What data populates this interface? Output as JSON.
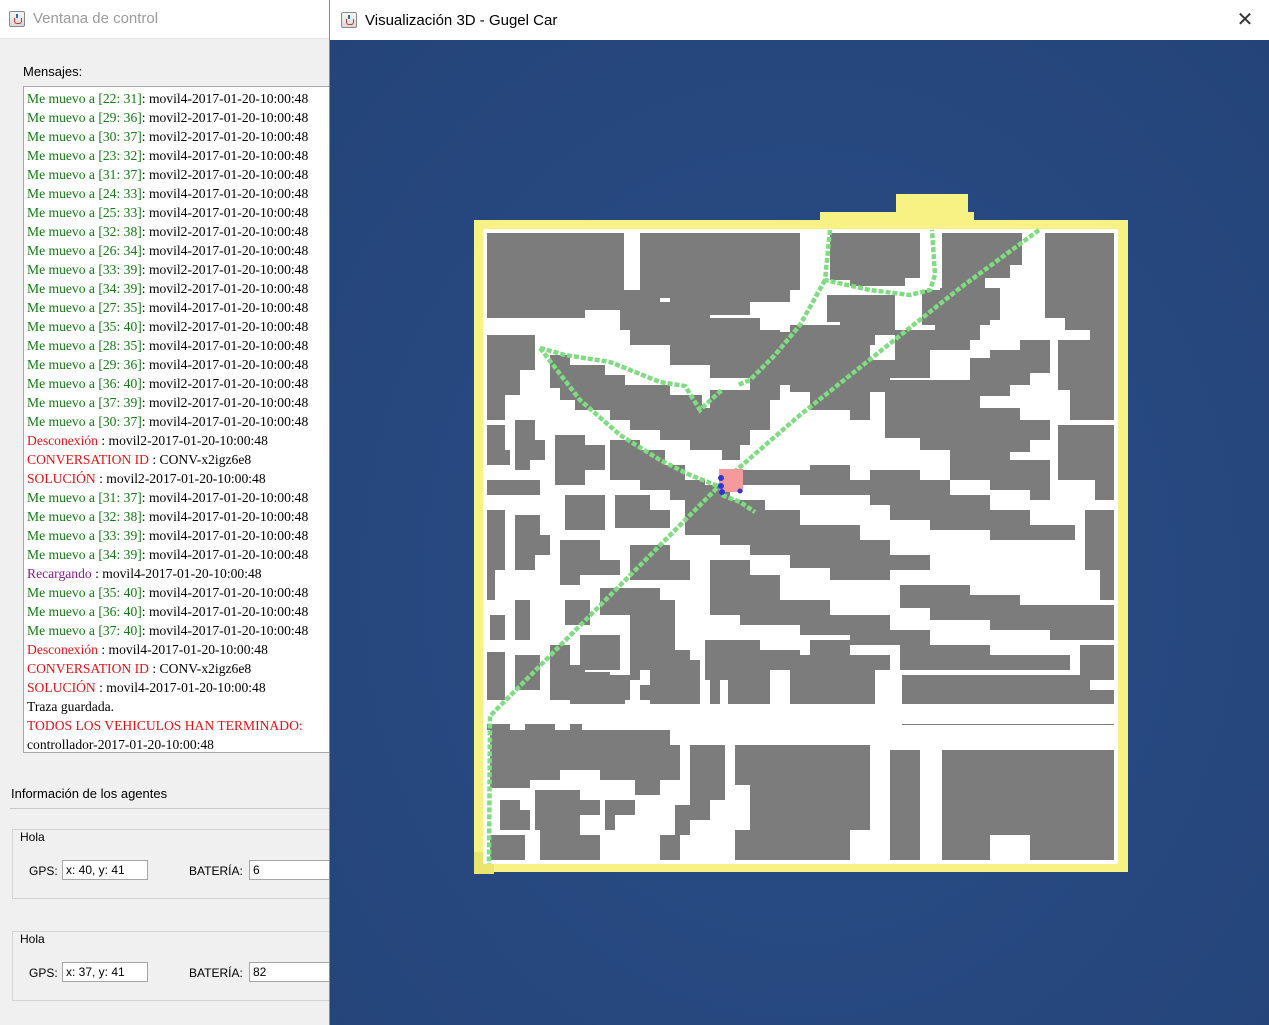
{
  "control_window": {
    "title": "Ventana de control",
    "icon": "java-cup-icon",
    "messages_label": "Mensajes:",
    "messages": [
      {
        "key": "Me muevo a [22: 31]",
        "kind": "green",
        "text": ": movil4-2017-01-20-10:00:48"
      },
      {
        "key": "Me muevo a [29: 36]",
        "kind": "green",
        "text": ": movil2-2017-01-20-10:00:48"
      },
      {
        "key": "Me muevo a [30: 37]",
        "kind": "green",
        "text": ": movil2-2017-01-20-10:00:48"
      },
      {
        "key": "Me muevo a [23: 32]",
        "kind": "green",
        "text": ": movil4-2017-01-20-10:00:48"
      },
      {
        "key": "Me muevo a [31: 37]",
        "kind": "green",
        "text": ": movil2-2017-01-20-10:00:48"
      },
      {
        "key": "Me muevo a [24: 33]",
        "kind": "green",
        "text": ": movil4-2017-01-20-10:00:48"
      },
      {
        "key": "Me muevo a [25: 33]",
        "kind": "green",
        "text": ": movil4-2017-01-20-10:00:48"
      },
      {
        "key": "Me muevo a [32: 38]",
        "kind": "green",
        "text": ": movil2-2017-01-20-10:00:48"
      },
      {
        "key": "Me muevo a [26: 34]",
        "kind": "green",
        "text": ": movil4-2017-01-20-10:00:48"
      },
      {
        "key": "Me muevo a [33: 39]",
        "kind": "green",
        "text": ": movil2-2017-01-20-10:00:48"
      },
      {
        "key": "Me muevo a [34: 39]",
        "kind": "green",
        "text": ": movil2-2017-01-20-10:00:48"
      },
      {
        "key": "Me muevo a [27: 35]",
        "kind": "green",
        "text": ": movil4-2017-01-20-10:00:48"
      },
      {
        "key": "Me muevo a [35: 40]",
        "kind": "green",
        "text": ": movil2-2017-01-20-10:00:48"
      },
      {
        "key": "Me muevo a [28: 35]",
        "kind": "green",
        "text": ": movil4-2017-01-20-10:00:48"
      },
      {
        "key": "Me muevo a [29: 36]",
        "kind": "green",
        "text": ": movil4-2017-01-20-10:00:48"
      },
      {
        "key": "Me muevo a [36: 40]",
        "kind": "green",
        "text": ": movil2-2017-01-20-10:00:48"
      },
      {
        "key": "Me muevo a [37: 39]",
        "kind": "green",
        "text": ": movil2-2017-01-20-10:00:48"
      },
      {
        "key": "Me muevo a [30: 37]",
        "kind": "green",
        "text": ": movil4-2017-01-20-10:00:48"
      },
      {
        "key": "Desconexión",
        "kind": "red",
        "text": " : movil2-2017-01-20-10:00:48"
      },
      {
        "key": "CONVERSATION ID",
        "kind": "red",
        "text": " : CONV-x2igz6e8"
      },
      {
        "key": "SOLUCIÓN",
        "kind": "red",
        "text": " : movil2-2017-01-20-10:00:48"
      },
      {
        "key": "Me muevo a [31: 37]",
        "kind": "green",
        "text": ": movil4-2017-01-20-10:00:48"
      },
      {
        "key": "Me muevo a [32: 38]",
        "kind": "green",
        "text": ": movil4-2017-01-20-10:00:48"
      },
      {
        "key": "Me muevo a [33: 39]",
        "kind": "green",
        "text": ": movil4-2017-01-20-10:00:48"
      },
      {
        "key": "Me muevo a [34: 39]",
        "kind": "green",
        "text": ": movil4-2017-01-20-10:00:48"
      },
      {
        "key": "Recargando",
        "kind": "purple",
        "text": " : movil4-2017-01-20-10:00:48"
      },
      {
        "key": "Me muevo a [35: 40]",
        "kind": "green",
        "text": ": movil4-2017-01-20-10:00:48"
      },
      {
        "key": "Me muevo a [36: 40]",
        "kind": "green",
        "text": ": movil4-2017-01-20-10:00:48"
      },
      {
        "key": "Me muevo a [37: 40]",
        "kind": "green",
        "text": ": movil4-2017-01-20-10:00:48"
      },
      {
        "key": "Desconexión",
        "kind": "red",
        "text": " : movil4-2017-01-20-10:00:48"
      },
      {
        "key": "CONVERSATION ID",
        "kind": "red",
        "text": " : CONV-x2igz6e8"
      },
      {
        "key": "SOLUCIÓN",
        "kind": "red",
        "text": " : movil4-2017-01-20-10:00:48"
      },
      {
        "key": "Traza guardada.",
        "kind": "black",
        "text": ""
      },
      {
        "key": "TODOS LOS VEHICULOS HAN TERMINADO:",
        "kind": "red",
        "text": ""
      },
      {
        "key": "",
        "kind": "black",
        "text": "controllador-2017-01-20-10:00:48"
      }
    ],
    "agents_heading": "Información de los agentes",
    "agents": [
      {
        "name": "Hola",
        "gps_label": "GPS:",
        "gps_value": "x: 40, y: 41",
        "battery_label": "BATERÍA:",
        "battery_value": "6"
      },
      {
        "name": "Hola",
        "gps_label": "GPS:",
        "gps_value": "x: 37, y: 41",
        "battery_label": "BATERÍA:",
        "battery_value": "82"
      }
    ]
  },
  "viz_window": {
    "title": "Visualización 3D - Gugel Car",
    "icon": "java-cup-icon",
    "close_icon": "close-icon",
    "close_glyph": "✕",
    "colors": {
      "background": "#274a82",
      "wall": "#f7f283",
      "road": "#ffffff",
      "building": "#7c7c7c",
      "trace": "#7fdc80",
      "goal": "#f59a9a",
      "vehicle": "#2f36d6"
    }
  }
}
